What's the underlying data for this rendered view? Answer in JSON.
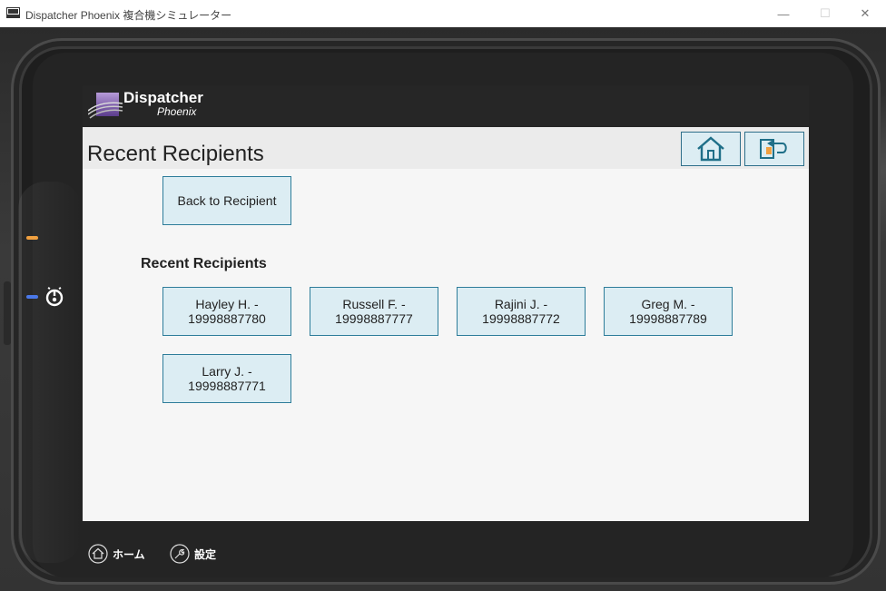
{
  "window": {
    "title": "Dispatcher Phoenix 複合機シミュレーター",
    "minimize_glyph": "—",
    "maximize_glyph": "☐",
    "close_glyph": "✕"
  },
  "brand": {
    "name": "Dispatcher",
    "subname": "Phoenix"
  },
  "page": {
    "title": "Recent Recipients",
    "home_icon": "home-icon",
    "back_icon": "back-icon"
  },
  "actions": {
    "back_to_recipient": "Back to Recipient"
  },
  "recipients_section": {
    "label": "Recent Recipients",
    "items": [
      {
        "name": "Hayley H. -",
        "number": "19998887780"
      },
      {
        "name": "Russell F. -",
        "number": "19998887777"
      },
      {
        "name": "Rajini J. -",
        "number": "19998887772"
      },
      {
        "name": "Greg M. -",
        "number": "19998887789"
      },
      {
        "name": "Larry J. -",
        "number": "19998887771"
      }
    ]
  },
  "bottom_bar": {
    "home_label": "ホーム",
    "settings_label": "設定"
  },
  "colors": {
    "button_bg": "#dcedf3",
    "button_border": "#2e7d9a",
    "led_orange": "#f0a040",
    "led_blue": "#4a78e8"
  }
}
